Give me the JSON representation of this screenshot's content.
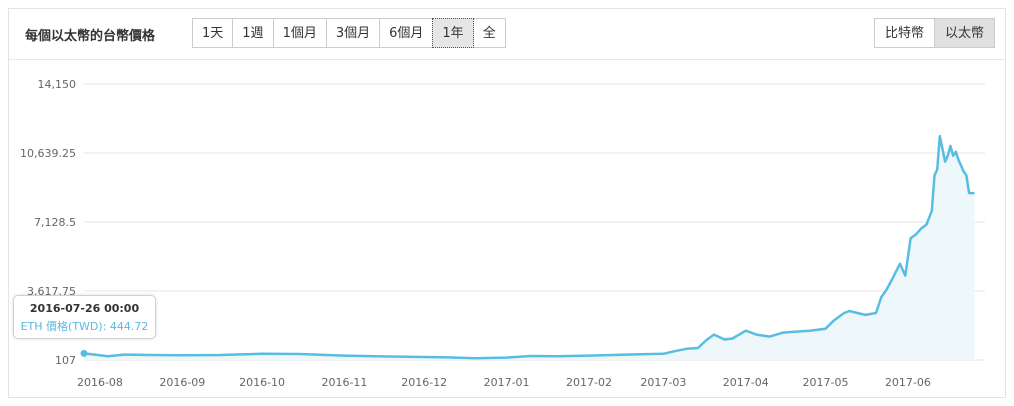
{
  "header": {
    "title": "每個以太幣的台幣價格",
    "ranges": [
      "1天",
      "1週",
      "1個月",
      "3個月",
      "6個月",
      "1年",
      "全"
    ],
    "active_range": "1年",
    "coins": [
      "比特幣",
      "以太幣"
    ],
    "active_coin": "以太幣"
  },
  "tooltip": {
    "date": "2016-07-26 00:00",
    "label": "ETH 價格(TWD): 444.72"
  },
  "colors": {
    "line": "#58bde0",
    "fill": "#eef8fb",
    "grid": "#e6e6e6"
  },
  "chart_data": {
    "type": "area",
    "title": "",
    "xlabel": "",
    "ylabel": "",
    "yticks": [
      "14,150",
      "10,639.25",
      "7,128.5",
      "3,617.75",
      "107"
    ],
    "ytick_values": [
      14150,
      10639.25,
      7128.5,
      3617.75,
      107
    ],
    "ylim": [
      107,
      14150
    ],
    "xticks": [
      "2016-08",
      "2016-09",
      "2016-10",
      "2016-11",
      "2016-12",
      "2017-01",
      "2017-02",
      "2017-03",
      "2017-04",
      "2017-05",
      "2017-06"
    ],
    "xtick_dates": [
      "2016-08-01",
      "2016-09-01",
      "2016-10-01",
      "2016-11-01",
      "2016-12-01",
      "2017-01-01",
      "2017-02-01",
      "2017-03-01",
      "2017-04-01",
      "2017-05-01",
      "2017-06-01"
    ],
    "grid": true,
    "series": [
      {
        "name": "ETH 價格(TWD)",
        "x": [
          "2016-07-26",
          "2016-08-01",
          "2016-08-04",
          "2016-08-10",
          "2016-08-20",
          "2016-09-01",
          "2016-09-15",
          "2016-10-01",
          "2016-10-15",
          "2016-11-01",
          "2016-11-15",
          "2016-12-01",
          "2016-12-10",
          "2016-12-20",
          "2017-01-01",
          "2017-01-10",
          "2017-01-20",
          "2017-02-01",
          "2017-02-15",
          "2017-03-01",
          "2017-03-05",
          "2017-03-10",
          "2017-03-14",
          "2017-03-17",
          "2017-03-20",
          "2017-03-24",
          "2017-03-27",
          "2017-04-01",
          "2017-04-05",
          "2017-04-10",
          "2017-04-15",
          "2017-04-20",
          "2017-04-25",
          "2017-05-01",
          "2017-05-04",
          "2017-05-06",
          "2017-05-08",
          "2017-05-10",
          "2017-05-13",
          "2017-05-16",
          "2017-05-20",
          "2017-05-22",
          "2017-05-24",
          "2017-05-26",
          "2017-05-29",
          "2017-05-31",
          "2017-06-02",
          "2017-06-04",
          "2017-06-06",
          "2017-06-08",
          "2017-06-10",
          "2017-06-11",
          "2017-06-12",
          "2017-06-13",
          "2017-06-15",
          "2017-06-16",
          "2017-06-17",
          "2017-06-18",
          "2017-06-19",
          "2017-06-20",
          "2017-06-22",
          "2017-06-23",
          "2017-06-24",
          "2017-06-26"
        ],
        "values": [
          444.72,
          350,
          300,
          380,
          360,
          350,
          360,
          420,
          410,
          330,
          290,
          260,
          240,
          200,
          230,
          310,
          300,
          330,
          380,
          420,
          550,
          680,
          720,
          1100,
          1400,
          1150,
          1200,
          1600,
          1400,
          1300,
          1500,
          1550,
          1600,
          1700,
          2100,
          2300,
          2500,
          2600,
          2500,
          2400,
          2500,
          3300,
          3700,
          4200,
          5000,
          4400,
          6300,
          6500,
          6800,
          7000,
          7700,
          9500,
          9800,
          11500,
          10200,
          10500,
          11000,
          10500,
          10700,
          10300,
          9700,
          9500,
          8600,
          8600
        ]
      }
    ]
  }
}
